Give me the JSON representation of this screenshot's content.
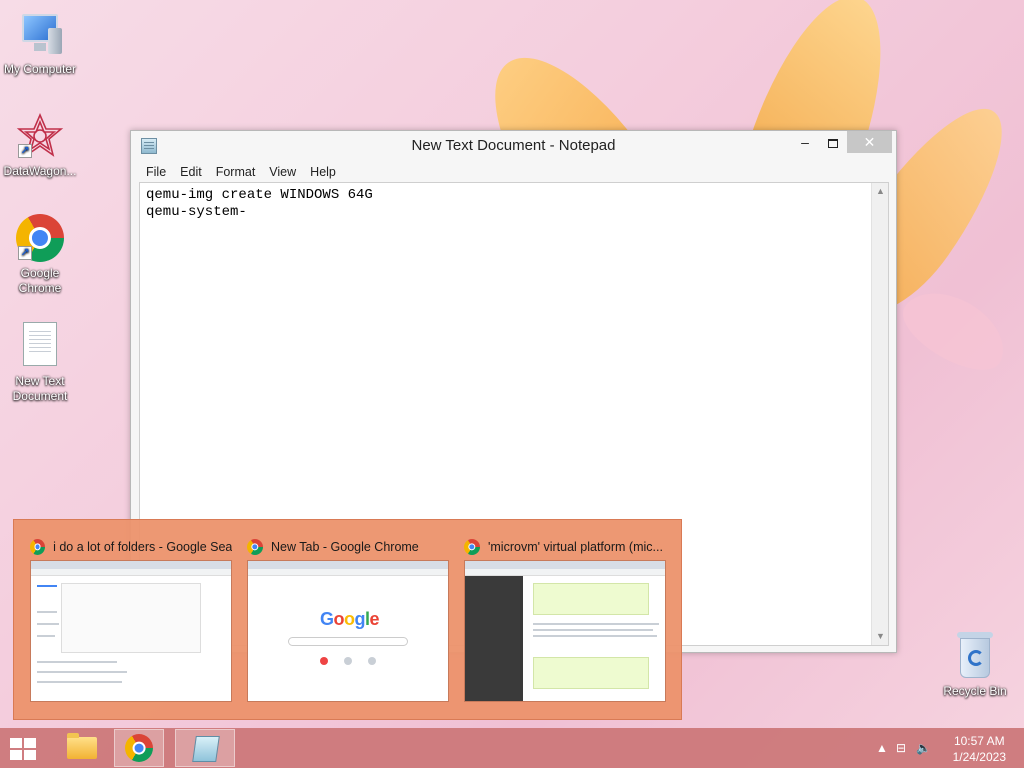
{
  "desktop": {
    "icons": [
      {
        "label": "My Computer"
      },
      {
        "label": "DataWagon..."
      },
      {
        "label": "Google Chrome"
      },
      {
        "label": "New Text Document"
      },
      {
        "label": "Recycle Bin"
      }
    ]
  },
  "notepad": {
    "title": "New Text Document - Notepad",
    "menu": [
      "File",
      "Edit",
      "Format",
      "View",
      "Help"
    ],
    "content": "qemu-img create WINDOWS 64G\nqemu-system-",
    "buttons": {
      "minimize": "–",
      "close": "✕"
    }
  },
  "chrome_previews": [
    {
      "title": "i do a lot of folders - Google Sea..."
    },
    {
      "title": "New Tab - Google Chrome"
    },
    {
      "title": "'microvm' virtual platform (mic..."
    }
  ],
  "taskbar": {
    "time": "10:57 AM",
    "date": "1/24/2023"
  },
  "colors": {
    "taskbar": "#cc787a",
    "flyout": "#ec926c"
  }
}
